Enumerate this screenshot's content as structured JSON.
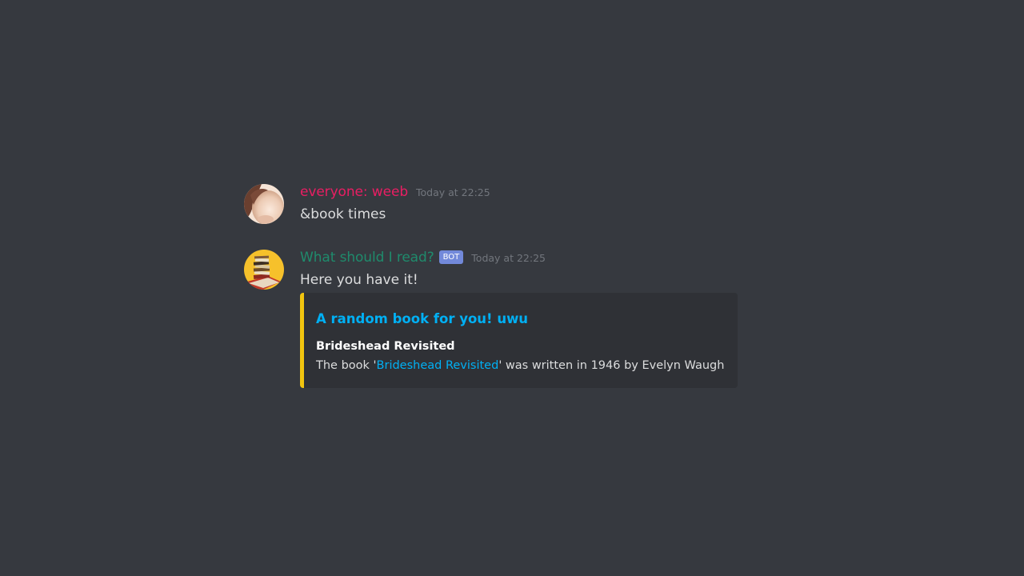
{
  "colors": {
    "background": "#36393f",
    "user_name_color": "#e91e63",
    "bot_name_color": "#1f8b6c",
    "embed_accent": "#f1c40f",
    "link": "#00b0f4",
    "bot_tag": "#7289da"
  },
  "messages": [
    {
      "author": "everyone: weeb",
      "timestamp": "Today at 22:25",
      "content": "&book times",
      "avatar_icon": "user-avatar"
    },
    {
      "author": "What should I read?",
      "bot_tag": "BOT",
      "timestamp": "Today at 22:25",
      "content": "Here you have it!",
      "avatar_icon": "book-stack-avatar",
      "embed": {
        "title": "A random book for you! uwu",
        "field_name": "Brideshead Revisited",
        "field_value_prefix": "The book '",
        "field_value_link": "Brideshead Revisited",
        "field_value_suffix": "' was written in 1946 by Evelyn Waugh"
      }
    }
  ]
}
